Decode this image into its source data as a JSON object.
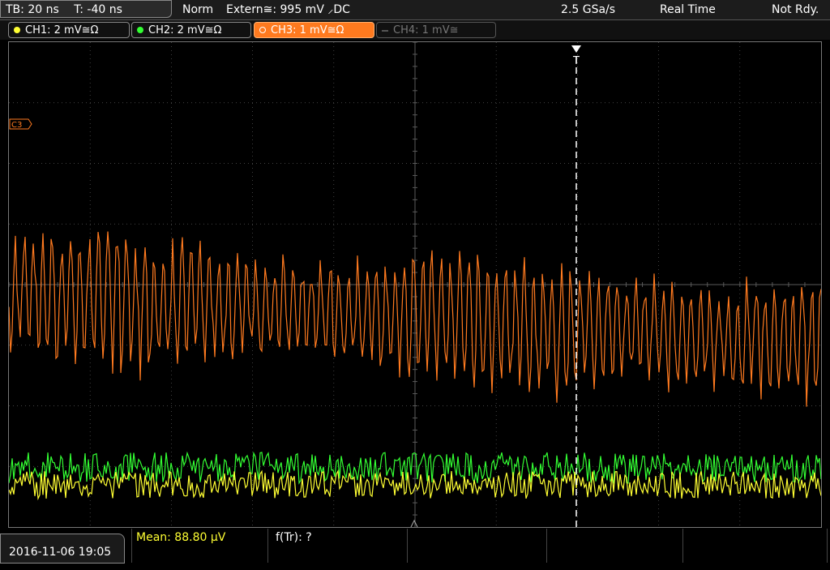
{
  "header": {
    "timebase": "TB: 20 ns",
    "trigger_time": "T: -40 ns",
    "trigger_mode": "Norm",
    "trigger_source": "Extern≅: 995 mV ⸝DC",
    "sample_rate": "2.5 GSa/s",
    "acq_mode": "Real Time",
    "status": "Not Rdy."
  },
  "channels": [
    {
      "label": "CH1: 2 mV≅Ω",
      "color": "#ffff33",
      "state": "on"
    },
    {
      "label": "CH2: 2 mV≅Ω",
      "color": "#33ff33",
      "state": "on"
    },
    {
      "label": "CH3: 1 mV≅Ω",
      "color": "#ff7a1f",
      "state": "active"
    },
    {
      "label": "CH4: 1 mV≅",
      "color": "#777777",
      "state": "off"
    }
  ],
  "markers": {
    "ch3_ref": "C3",
    "trigger": "T"
  },
  "footer": {
    "datetime": "2016-11-06 19:05",
    "mean": "Mean: 88.80 µV",
    "ftr": "f(Tr): ?"
  },
  "colors": {
    "grid": "#5a5a5a",
    "ch1": "#ffff33",
    "ch2": "#33ff33",
    "ch3": "#ff7a1f"
  }
}
